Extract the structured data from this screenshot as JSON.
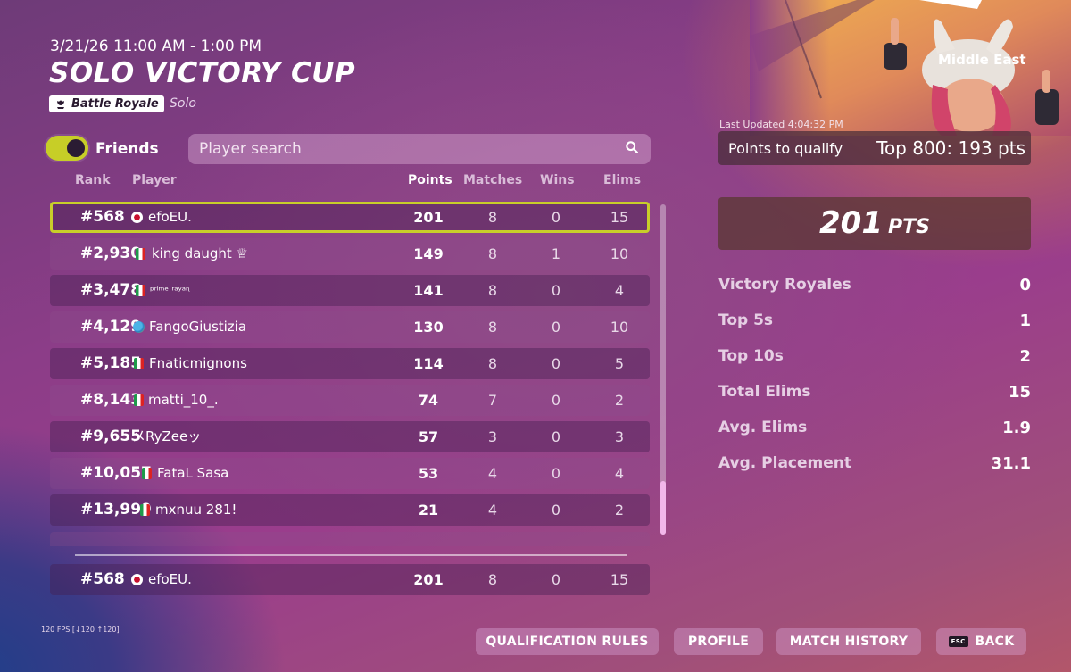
{
  "header": {
    "date": "3/21/26 11:00 AM - 1:00 PM",
    "title": "SOLO VICTORY CUP",
    "mode_badge": "Battle Royale",
    "mode_sub": "Solo"
  },
  "filters": {
    "friends_label": "Friends",
    "friends_on": true,
    "search_placeholder": "Player search"
  },
  "columns": {
    "rank": "Rank",
    "player": "Player",
    "points": "Points",
    "matches": "Matches",
    "wins": "Wins",
    "elims": "Elims"
  },
  "rows": [
    {
      "rank": "#568",
      "flag": "jp",
      "player": "efoEU.",
      "points": "201",
      "matches": "8",
      "wins": "0",
      "elims": "15",
      "selected": true
    },
    {
      "rank": "#2,930",
      "flag": "it",
      "player": "king daught ♕",
      "points": "149",
      "matches": "8",
      "wins": "1",
      "elims": "10"
    },
    {
      "rank": "#3,478",
      "flag": "it",
      "player": "ᵖʳⁱᵐᵉ ʳᵃʸᵃᶯ",
      "points": "141",
      "matches": "8",
      "wins": "0",
      "elims": "4"
    },
    {
      "rank": "#4,129",
      "flag": "gl",
      "player": "FangoGiustizia",
      "points": "130",
      "matches": "8",
      "wins": "0",
      "elims": "10"
    },
    {
      "rank": "#5,185",
      "flag": "it",
      "player": "Fnaticmignons",
      "points": "114",
      "matches": "8",
      "wins": "0",
      "elims": "5"
    },
    {
      "rank": "#8,143",
      "flag": "it",
      "player": "matti_10_.",
      "points": "74",
      "matches": "7",
      "wins": "0",
      "elims": "2"
    },
    {
      "rank": "#9,655",
      "flag": "",
      "player": "メRyZeeッ",
      "points": "57",
      "matches": "3",
      "wins": "0",
      "elims": "3"
    },
    {
      "rank": "#10,057",
      "flag": "it",
      "player": "FataL Sasa",
      "points": "53",
      "matches": "4",
      "wins": "0",
      "elims": "4"
    },
    {
      "rank": "#13,999",
      "flag": "it",
      "player": "mxnuu 281!",
      "points": "21",
      "matches": "4",
      "wins": "0",
      "elims": "2"
    }
  ],
  "my_row": {
    "rank": "#568",
    "flag": "jp",
    "player": "efoEU.",
    "points": "201",
    "matches": "8",
    "wins": "0",
    "elims": "15"
  },
  "fps": "120 FPS [↓120 ↑120]",
  "buttons": {
    "qualification": "QUALIFICATION RULES",
    "profile": "PROFILE",
    "match_history": "MATCH HISTORY",
    "back": "BACK",
    "back_key": "ESC"
  },
  "side": {
    "region": "Middle East",
    "last_updated": "Last Updated 4:04:32 PM",
    "qualify_label": "Points to qualify",
    "qualify_value": "Top 800: 193 pts",
    "total_points": "201",
    "points_unit": "PTS",
    "stats": [
      {
        "label": "Victory Royales",
        "value": "0"
      },
      {
        "label": "Top 5s",
        "value": "1"
      },
      {
        "label": "Top 10s",
        "value": "2"
      },
      {
        "label": "Total Elims",
        "value": "15"
      },
      {
        "label": "Avg. Elims",
        "value": "1.9"
      },
      {
        "label": "Avg. Placement",
        "value": "31.1"
      }
    ]
  },
  "colors": {
    "highlight": "#c8ce2a",
    "toggle_on": "#c7ce27"
  }
}
